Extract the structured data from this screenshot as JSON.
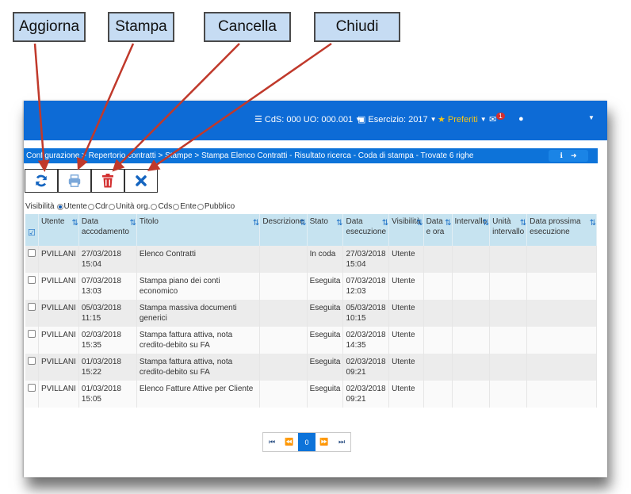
{
  "callouts": {
    "aggiorna": "Aggiorna",
    "stampa": "Stampa",
    "cancella": "Cancella",
    "chiudi": "Chiudi"
  },
  "topbar": {
    "cds": "CdS: 000 UO: 000.001",
    "esercizio": "Esercizio: 2017",
    "preferiti": "Preferiti",
    "mail_badge": "1"
  },
  "breadcrumb": {
    "text": "Configurazione > Repertorio contratti > Stampe > Stampa Elenco Contratti - Risultato ricerca - Coda di stampa - Trovate 6 righe"
  },
  "visibility": {
    "label": "Visibilità",
    "options": [
      "Utente",
      "Cdr",
      "Unità org.",
      "Cds",
      "Ente",
      "Pubblico"
    ],
    "selected": "Utente"
  },
  "table": {
    "headers": [
      "Utente",
      "Data accodamento",
      "Titolo",
      "Descrizione",
      "Stato",
      "Data esecuzione",
      "Visibilità",
      "Data e ora",
      "Intervallo",
      "Unità intervallo",
      "Data prossima esecuzione"
    ],
    "rows": [
      [
        "PVILLANI",
        "27/03/2018 15:04",
        "Elenco Contratti",
        "",
        "In coda",
        "27/03/2018 15:04",
        "Utente",
        "",
        "",
        "",
        ""
      ],
      [
        "PVILLANI",
        "07/03/2018 13:03",
        "Stampa piano dei conti economico",
        "",
        "Eseguita",
        "07/03/2018 12:03",
        "Utente",
        "",
        "",
        "",
        ""
      ],
      [
        "PVILLANI",
        "05/03/2018 11:15",
        "Stampa massiva documenti generici",
        "",
        "Eseguita",
        "05/03/2018 10:15",
        "Utente",
        "",
        "",
        "",
        ""
      ],
      [
        "PVILLANI",
        "02/03/2018 15:35",
        "Stampa fattura attiva, nota credito-debito su FA",
        "",
        "Eseguita",
        "02/03/2018 14:35",
        "Utente",
        "",
        "",
        "",
        ""
      ],
      [
        "PVILLANI",
        "01/03/2018 15:22",
        "Stampa fattura attiva, nota credito-debito su FA",
        "",
        "Eseguita",
        "02/03/2018 09:21",
        "Utente",
        "",
        "",
        "",
        ""
      ],
      [
        "PVILLANI",
        "01/03/2018 15:05",
        "Elenco Fatture Attive per Cliente",
        "",
        "Eseguita",
        "02/03/2018 09:21",
        "Utente",
        "",
        "",
        "",
        ""
      ]
    ]
  },
  "pager": {
    "current": "0"
  },
  "colors": {
    "blue": "#0d6bd6",
    "header": "#c6e3f0",
    "refresh": "#1565c0",
    "delete": "#d32f2f"
  }
}
